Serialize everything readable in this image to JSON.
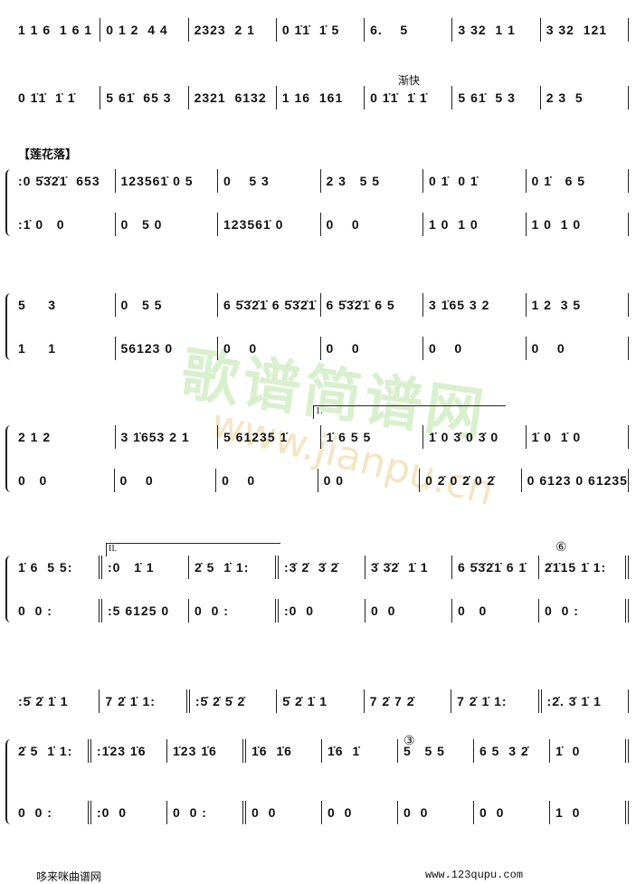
{
  "section_label": "【莲花落】",
  "tempo_marking": "渐快",
  "volta_1": "1.",
  "volta_2": "II.",
  "circled_6": "⑥",
  "circled_3": "③",
  "watermark": {
    "text": "歌谱简谱网",
    "url": "www.jianpu.cn"
  },
  "footer": {
    "site_name": "哆来咪曲谱网",
    "site_url": "www.123qupu.com"
  },
  "systems": [
    {
      "top": [
        [
          "1 1 6  1 6 1",
          0
        ],
        [
          "0 1 2  4 4",
          0
        ],
        [
          "2323  2 1",
          0
        ],
        [
          "0 1̇1̇  1̇ 5",
          0
        ],
        [
          "6.    5",
          0
        ],
        [
          "3 32  1 1",
          0
        ],
        [
          "3 32  121",
          0
        ]
      ]
    },
    {
      "top": [
        [
          "0 1̇1̇  1̇ 1̇",
          0
        ],
        [
          "5 61̇  65 3",
          0
        ],
        [
          "2321  6132",
          0
        ],
        [
          "1 16  161",
          0
        ],
        [
          "0 1̇1̇  1̇ 1̇",
          0
        ],
        [
          "5 61̇  5 3",
          0
        ],
        [
          "2 3  5",
          0
        ]
      ]
    },
    {
      "top": [
        [
          ":0 5̇3̇2̇1̇  653",
          0
        ],
        [
          "123561̇ 0 5",
          0
        ],
        [
          "0    5 3",
          0
        ],
        [
          "2 3   5 5",
          0
        ],
        [
          "0 1̇  0 1̇",
          0
        ],
        [
          "0 1̇   6 5",
          0
        ]
      ],
      "bottom": [
        [
          ":1̇ 0   0",
          0
        ],
        [
          "0   5 0",
          0
        ],
        [
          "123561̇ 0",
          0
        ],
        [
          "0    0",
          0
        ],
        [
          "1 0  1 0",
          0
        ],
        [
          "1 0  1 0",
          0
        ]
      ]
    },
    {
      "top": [
        [
          "5     3",
          0
        ],
        [
          "0   5 5",
          0
        ],
        [
          "6 5̇3̇2̇1̇ 6 5̇3̇2̇1̇",
          0
        ],
        [
          "6 5̇3̇2̇1̇ 6 5",
          0
        ],
        [
          "3 1̇65 3 2",
          0
        ],
        [
          "1 2  3 5",
          0
        ]
      ],
      "bottom": [
        [
          "1     1",
          0
        ],
        [
          "56123 0",
          0
        ],
        [
          "0    0",
          0
        ],
        [
          "0    0",
          0
        ],
        [
          "0    0",
          0
        ],
        [
          "0    0",
          0
        ]
      ]
    },
    {
      "top": [
        [
          "2 1 2",
          0
        ],
        [
          "3 1̇653 2 1",
          0
        ],
        [
          "5 61235 1̇",
          0
        ],
        [
          "1̇ 6 5 5",
          0
        ],
        [
          "1̇ 0 3̇ 0 3̇ 0",
          0
        ],
        [
          "1̇ 0  1̇ 0",
          0
        ]
      ],
      "bottom": [
        [
          "0   0",
          0
        ],
        [
          "0    0",
          0
        ],
        [
          "0    0",
          0
        ],
        [
          "0 0",
          0
        ],
        [
          "0 2̇ 0 2̇ 0 2̇",
          0
        ],
        [
          "0 6123 0 61235",
          0
        ]
      ]
    },
    {
      "top": [
        [
          "1̇ 6  5 5:",
          1
        ],
        [
          ":0   1̇ 1",
          0
        ],
        [
          "2̇ 5  1̇ 1:",
          1
        ],
        [
          ":3̇ 2̇  3̇ 2̇",
          0
        ],
        [
          "3̇ 3̇2̇  1̇ 1",
          0
        ],
        [
          "6 5̇3̇2̇1̇ 6 1̇",
          0
        ],
        [
          "2̇1̇15 1̇ 1:",
          1
        ]
      ],
      "bottom": [
        [
          "0  0 :",
          1
        ],
        [
          ":5 6125 0",
          0
        ],
        [
          "0  0 :",
          1
        ],
        [
          ":0  0",
          0
        ],
        [
          "0  0",
          0
        ],
        [
          "0   0",
          0
        ],
        [
          "0  0 :",
          1
        ]
      ]
    },
    {
      "top": [
        [
          ":5̇ 2̇ 1̇ 1",
          0
        ],
        [
          "7 2̇ 1̇ 1:",
          1
        ],
        [
          ":5̇ 2̇ 5̇ 2̇",
          0
        ],
        [
          "5̇ 2̇ 1̇ 1",
          0
        ],
        [
          "7 2̇ 7 2̇",
          0
        ],
        [
          "7 2̇ 1̇ 1:",
          1
        ],
        [
          ":2̇. 3̇ 1̇ 1",
          0
        ]
      ]
    },
    {
      "top": [
        [
          "2̇ 5  1̇ 1:",
          1
        ],
        [
          ":1̇23 1̇6",
          0
        ],
        [
          "1̇23 1̇6",
          1
        ],
        [
          "1̇6  1̇6",
          0
        ],
        [
          "1̇6  1̇",
          0
        ],
        [
          "5   5 5",
          0
        ],
        [
          "6 5  3 2̇",
          0
        ],
        [
          "1̇  0",
          1
        ]
      ],
      "bottom": [
        [
          "0  0 :",
          1
        ],
        [
          ":0  0",
          0
        ],
        [
          "0  0 :",
          1
        ],
        [
          "0  0",
          0
        ],
        [
          "0  0",
          0
        ],
        [
          "0  0",
          0
        ],
        [
          "0  0",
          0
        ],
        [
          "1  0",
          1
        ]
      ]
    }
  ]
}
